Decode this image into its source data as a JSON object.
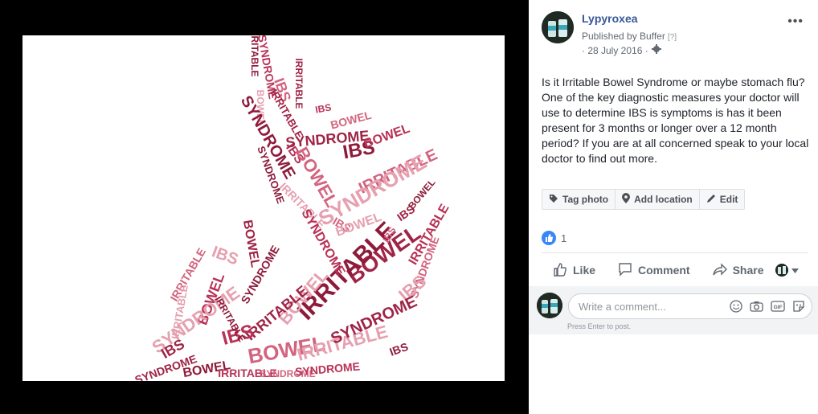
{
  "post": {
    "author": "Lypyroxea",
    "published_by": "Published by Buffer",
    "published_help": "[?]",
    "date": "· 28 July 2016 ·",
    "body": "Is it Irritable Bowel Syndrome or maybe stomach flu? One of the key diagnostic measures your doctor will use to determine IBS is symptoms is has it been present for 3 months or longer over a 12 month period? If you are at all concerned speak to your local doctor to find out more.",
    "more_label": "•••"
  },
  "photo_actions": {
    "tag_photo": "Tag photo",
    "add_location": "Add location",
    "edit": "Edit"
  },
  "reactions": {
    "count": "1"
  },
  "ufi": {
    "like": "Like",
    "comment": "Comment",
    "share": "Share"
  },
  "comment": {
    "placeholder": "Write a comment...",
    "hint": "Press Enter to post."
  },
  "photo": {
    "words": [
      "IRRITABLE",
      "SYNDROME",
      "IBS",
      "BOWEL"
    ],
    "colors": [
      "#8e1b3b",
      "#b83256",
      "#d3647f",
      "#e6a0b0",
      "#a02446"
    ]
  },
  "icons": {
    "more": "more-dots-icon",
    "privacy": "gear-icon",
    "tag": "tag-icon",
    "location": "location-pin-icon",
    "edit": "pencil-icon",
    "like": "thumbs-up-icon",
    "comment": "speech-bubble-icon",
    "share": "share-arrow-icon",
    "emoji": "emoji-icon",
    "camera": "camera-icon",
    "gif": "gif-icon",
    "sticker": "sticker-icon"
  },
  "colors": {
    "link": "#385898",
    "like_blue": "#3b86f7"
  }
}
